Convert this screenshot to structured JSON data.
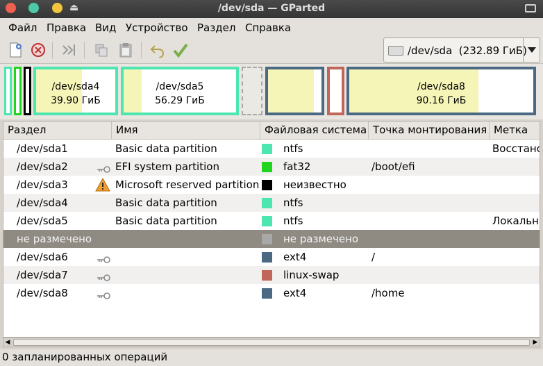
{
  "window": {
    "title": "/dev/sda — GParted"
  },
  "menu": [
    "Файл",
    "Правка",
    "Вид",
    "Устройство",
    "Раздел",
    "Справка"
  ],
  "toolbar": {
    "device": "/dev/sda  (232.89 ГиБ)"
  },
  "visual": {
    "sda4": {
      "name": "/dev/sda4",
      "size": "39.90 ГиБ",
      "used_fraction": 0.58
    },
    "sda5": {
      "name": "/dev/sda5",
      "size": "56.29 ГиБ",
      "used_fraction": 0.16
    },
    "sda6": {
      "used_fraction": 0.86
    },
    "sda8": {
      "name": "/dev/sda8",
      "size": "90.16 ГиБ",
      "used_fraction": 0.7
    }
  },
  "columns": [
    "Раздел",
    "Имя",
    "Файловая система",
    "Точка монтирования",
    "Метка"
  ],
  "rows": [
    {
      "partition": "/dev/sda1",
      "name": "Basic data partition",
      "fs": "ntfs",
      "mount": "",
      "label": "Восстановление",
      "color": "#4de6b0",
      "icon": ""
    },
    {
      "partition": "/dev/sda2",
      "name": "EFI system partition",
      "fs": "fat32",
      "mount": "/boot/efi",
      "label": "",
      "color": "#1fd51f",
      "icon": "key"
    },
    {
      "partition": "/dev/sda3",
      "name": "Microsoft reserved partition",
      "fs": "неизвестно",
      "mount": "",
      "label": "",
      "color": "#000000",
      "icon": "warning"
    },
    {
      "partition": "/dev/sda4",
      "name": "Basic data partition",
      "fs": "ntfs",
      "mount": "",
      "label": "",
      "color": "#4de6b0",
      "icon": ""
    },
    {
      "partition": "/dev/sda5",
      "name": "Basic data partition",
      "fs": "ntfs",
      "mount": "",
      "label": "Локальный диск",
      "color": "#4de6b0",
      "icon": ""
    },
    {
      "partition": "не размечено",
      "name": "",
      "fs": "не размечено",
      "mount": "",
      "label": "",
      "color": "#a8a8a8",
      "icon": "",
      "selected": true
    },
    {
      "partition": "/dev/sda6",
      "name": "",
      "fs": "ext4",
      "mount": "/",
      "label": "",
      "color": "#4b6983",
      "icon": "key"
    },
    {
      "partition": "/dev/sda7",
      "name": "",
      "fs": "linux-swap",
      "mount": "",
      "label": "",
      "color": "#c1665a",
      "icon": "key"
    },
    {
      "partition": "/dev/sda8",
      "name": "",
      "fs": "ext4",
      "mount": "/home",
      "label": "",
      "color": "#4b6983",
      "icon": "key"
    }
  ],
  "status": "0 запланированных операций",
  "colors": {
    "ntfs": "#4de6b0",
    "fat32": "#1fd51f",
    "ext4": "#4b6983",
    "swap": "#c1665a",
    "unallocated": "#a8a8a8",
    "used": "#f5f5b8"
  }
}
